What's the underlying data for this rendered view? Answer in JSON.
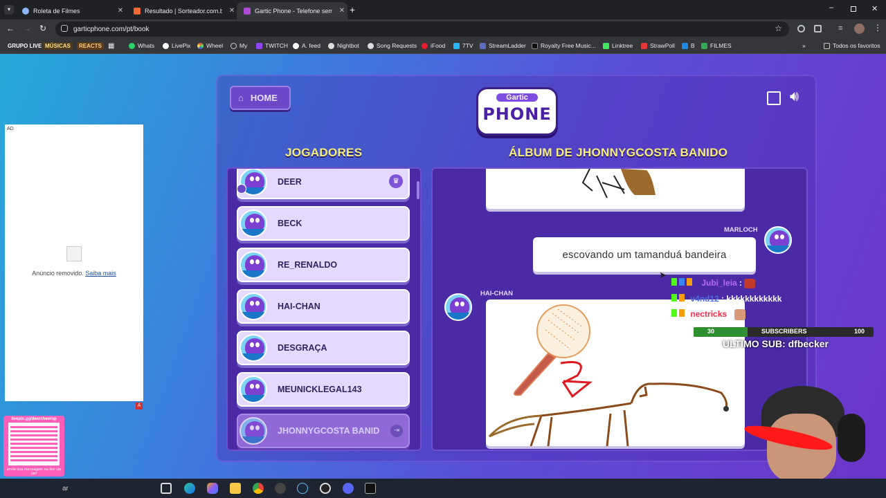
{
  "browser": {
    "tabs": [
      {
        "title": "Roleta de Filmes",
        "active": false
      },
      {
        "title": "Resultado | Sorteador.com.br -",
        "active": false
      },
      {
        "title": "Gartic Phone - Telefone sem fio",
        "active": true
      }
    ],
    "url": "garticphone.com/pt/book",
    "bookmarks": [
      "GRUPO LIVE",
      "MÚSICAS",
      "REACTS",
      "Whats",
      "LivePix",
      "Wheel",
      "My",
      "TWITCH",
      "A. feed",
      "Nightbot",
      "Song Requests",
      "iFood",
      "7TV",
      "StreamLadder",
      "Royalty Free Music...",
      "Linktree",
      "StrawPoll",
      "B",
      "FILMES"
    ],
    "all_bookmarks": "Todos os favoritos"
  },
  "ad": {
    "badge": "AD",
    "removed_text": "Anúncio removido.",
    "learn_more": "Saiba mais",
    "corner": "A"
  },
  "game": {
    "home_label": "HOME",
    "logo_top": "Gartic",
    "logo_bottom": "PHONE",
    "players_heading": "JOGADORES",
    "album_heading": "ÁLBUM DE JHONNYGCOSTA BANIDO",
    "players": [
      {
        "name": "DEER",
        "host": true
      },
      {
        "name": "BECK"
      },
      {
        "name": "RE_RENALDO"
      },
      {
        "name": "HAI-CHAN"
      },
      {
        "name": "DESGRAÇA"
      },
      {
        "name": "MEUNICKLEGAL143"
      },
      {
        "name": "JHONNYGCOSTA BANID",
        "current": true
      }
    ],
    "album": {
      "entry1_author": "MARLOCH",
      "entry1_text": "escovando um tamanduá bandeira",
      "entry2_author": "HAI-CHAN"
    }
  },
  "overlay": {
    "chat": [
      {
        "user": "Jubi_leia",
        "message": ""
      },
      {
        "user": "v4nd12",
        "message": "kkkkkkkkkkkk"
      },
      {
        "user": "nectricks",
        "message": ""
      }
    ],
    "sub_current": "30",
    "sub_label": "SUBSCRIBERS",
    "sub_goal": "100",
    "sub_progress": 0.3,
    "last_sub": "ULTIMO SUB: dfbecker",
    "qr_url": "livepix.gg/deercheerup",
    "qr_caption": "envie sua mensagem na live via pix!"
  },
  "taskbar": {
    "search_fragment": "ar"
  },
  "colors": {
    "heading": "#f7ef77",
    "panel": "#4a2aa5",
    "player_card": "#e6d9ff"
  }
}
